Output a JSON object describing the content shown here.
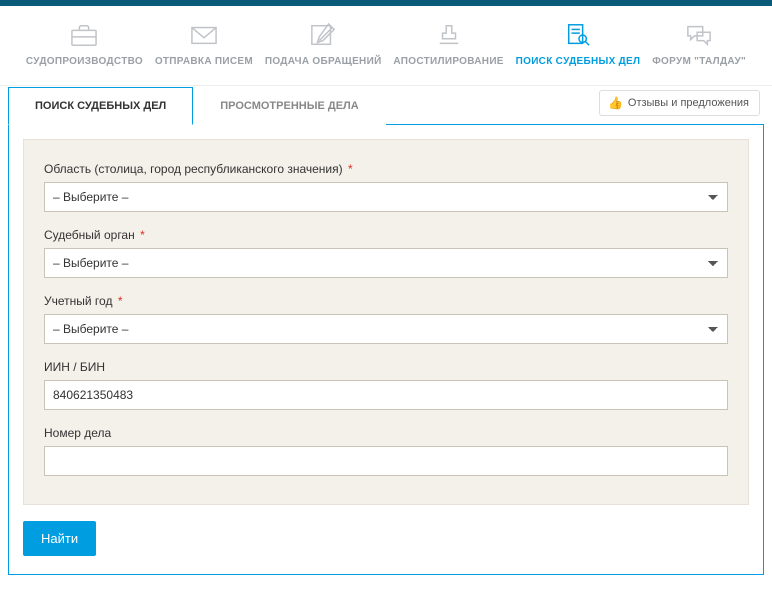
{
  "nav": {
    "items": [
      {
        "label": "СУДОПРОИЗВОДСТВО"
      },
      {
        "label": "ОТПРАВКА ПИСЕМ"
      },
      {
        "label": "ПОДАЧА ОБРАЩЕНИЙ"
      },
      {
        "label": "АПОСТИЛИРОВАНИЕ"
      },
      {
        "label": "ПОИСК СУДЕБНЫХ ДЕЛ"
      },
      {
        "label": "ФОРУМ \"ТАЛДАУ\""
      }
    ]
  },
  "feedback": {
    "label": "Отзывы и предложения"
  },
  "tabs": {
    "search": "ПОИСК СУДЕБНЫХ ДЕЛ",
    "viewed": "ПРОСМОТРЕННЫЕ ДЕЛА"
  },
  "form": {
    "region": {
      "label": "Область (столица, город республиканского значения)",
      "placeholder": "– Выберите –"
    },
    "court": {
      "label": "Судебный орган",
      "placeholder": "– Выберите –"
    },
    "year": {
      "label": "Учетный год",
      "placeholder": "– Выберите –"
    },
    "iin": {
      "label": "ИИН / БИН",
      "value": "840621350483"
    },
    "caseno": {
      "label": "Номер дела",
      "value": ""
    },
    "submit": "Найти"
  }
}
